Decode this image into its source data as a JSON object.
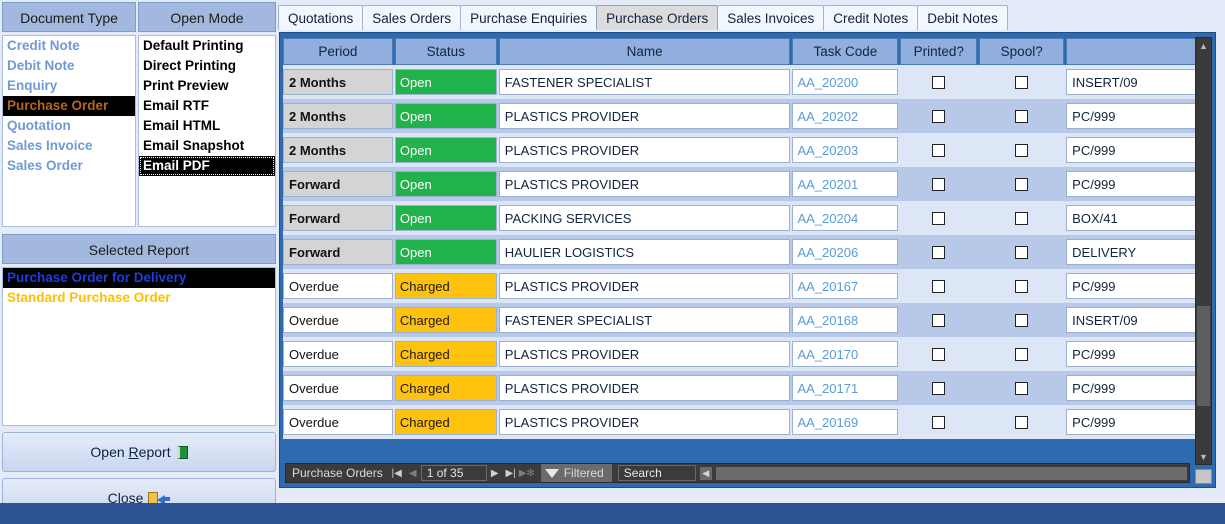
{
  "left": {
    "document_type": {
      "header": "Document Type",
      "items": [
        {
          "label": "Credit Note",
          "selected": false
        },
        {
          "label": "Debit Note",
          "selected": false
        },
        {
          "label": "Enquiry",
          "selected": false
        },
        {
          "label": "Purchase Order",
          "selected": true
        },
        {
          "label": "Quotation",
          "selected": false
        },
        {
          "label": "Sales Invoice",
          "selected": false
        },
        {
          "label": "Sales Order",
          "selected": false
        }
      ]
    },
    "open_mode": {
      "header": "Open Mode",
      "items": [
        {
          "label": "Default Printing",
          "selected": false
        },
        {
          "label": "Direct Printing",
          "selected": false
        },
        {
          "label": "Print Preview",
          "selected": false
        },
        {
          "label": "Email RTF",
          "selected": false
        },
        {
          "label": "Email HTML",
          "selected": false
        },
        {
          "label": "Email Snapshot",
          "selected": false
        },
        {
          "label": "Email PDF",
          "selected": true
        }
      ]
    },
    "selected_report": {
      "header": "Selected Report",
      "items": [
        {
          "label": "Purchase Order for Delivery",
          "selected": true
        },
        {
          "label": "Standard Purchase Order",
          "selected": false
        }
      ]
    },
    "buttons": {
      "open_report": {
        "pre": "Open ",
        "accel": "R",
        "post": "eport",
        "icon": "book-icon"
      },
      "close": {
        "pre": "",
        "accel": "C",
        "post": "lose",
        "icon": "door-exit-icon"
      }
    }
  },
  "tabs": [
    {
      "label": "Quotations",
      "active": false
    },
    {
      "label": "Sales Orders",
      "active": false
    },
    {
      "label": "Purchase Enquiries",
      "active": false
    },
    {
      "label": "Purchase Orders",
      "active": true
    },
    {
      "label": "Sales Invoices",
      "active": false
    },
    {
      "label": "Credit Notes",
      "active": false
    },
    {
      "label": "Debit Notes",
      "active": false
    }
  ],
  "grid": {
    "columns": [
      "Period",
      "Status",
      "Name",
      "Task Code",
      "Printed?",
      "Spool?",
      ""
    ],
    "rows": [
      {
        "period": "2 Months",
        "period_style": "bold",
        "status": "Open",
        "status_style": "open",
        "name": "FASTENER SPECIALIST",
        "task_code": "AA_20200",
        "printed": false,
        "spool": false,
        "ref": "INSERT/09"
      },
      {
        "period": "2 Months",
        "period_style": "bold",
        "status": "Open",
        "status_style": "open",
        "name": "PLASTICS PROVIDER",
        "task_code": "AA_20202",
        "printed": false,
        "spool": false,
        "ref": "PC/999"
      },
      {
        "period": "2 Months",
        "period_style": "bold",
        "status": "Open",
        "status_style": "open",
        "name": "PLASTICS PROVIDER",
        "task_code": "AA_20203",
        "printed": false,
        "spool": false,
        "ref": "PC/999"
      },
      {
        "period": "Forward",
        "period_style": "bold",
        "status": "Open",
        "status_style": "open",
        "name": "PLASTICS PROVIDER",
        "task_code": "AA_20201",
        "printed": false,
        "spool": false,
        "ref": "PC/999"
      },
      {
        "period": "Forward",
        "period_style": "bold",
        "status": "Open",
        "status_style": "open",
        "name": "PACKING SERVICES",
        "task_code": "AA_20204",
        "printed": false,
        "spool": false,
        "ref": "BOX/41"
      },
      {
        "period": "Forward",
        "period_style": "bold",
        "status": "Open",
        "status_style": "open",
        "name": "HAULIER LOGISTICS",
        "task_code": "AA_20206",
        "printed": false,
        "spool": false,
        "ref": "DELIVERY"
      },
      {
        "period": "Overdue",
        "period_style": "plain",
        "status": "Charged",
        "status_style": "charged",
        "name": "PLASTICS PROVIDER",
        "task_code": "AA_20167",
        "printed": false,
        "spool": false,
        "ref": "PC/999"
      },
      {
        "period": "Overdue",
        "period_style": "plain",
        "status": "Charged",
        "status_style": "charged",
        "name": "FASTENER SPECIALIST",
        "task_code": "AA_20168",
        "printed": false,
        "spool": false,
        "ref": "INSERT/09"
      },
      {
        "period": "Overdue",
        "period_style": "plain",
        "status": "Charged",
        "status_style": "charged",
        "name": "PLASTICS PROVIDER",
        "task_code": "AA_20170",
        "printed": false,
        "spool": false,
        "ref": "PC/999"
      },
      {
        "period": "Overdue",
        "period_style": "plain",
        "status": "Charged",
        "status_style": "charged",
        "name": "PLASTICS PROVIDER",
        "task_code": "AA_20171",
        "printed": false,
        "spool": false,
        "ref": "PC/999"
      },
      {
        "period": "Overdue",
        "period_style": "plain",
        "status": "Charged",
        "status_style": "charged",
        "name": "PLASTICS PROVIDER",
        "task_code": "AA_20169",
        "printed": false,
        "spool": false,
        "ref": "PC/999"
      }
    ]
  },
  "navbar": {
    "record_label": "Purchase Orders",
    "first_icon": "first-record-icon",
    "prev_icon": "previous-record-icon",
    "position": "1 of 35",
    "next_icon": "next-record-icon",
    "last_icon": "last-record-icon",
    "new_icon": "new-record-icon",
    "filter_icon": "funnel-icon",
    "filter_label": "Filtered",
    "search_value": "Search"
  },
  "colors": {
    "status_open": "#22b24c",
    "status_charged": "#ffc20e",
    "header_blue": "#90aede",
    "frame_blue": "#2e6ab0",
    "link_blue": "#5a9bd8",
    "selection_black": "#000000",
    "doc_selected_text": "#b5651d",
    "report_selected_text": "#1a3fe0",
    "report_alt_text": "#ffc000"
  }
}
